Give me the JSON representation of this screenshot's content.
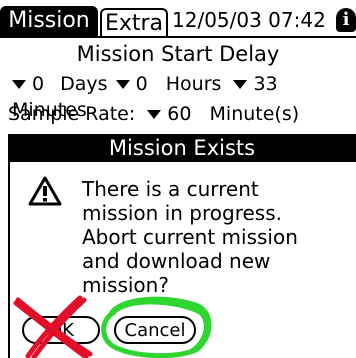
{
  "tabs": [
    {
      "label": "Mission"
    },
    {
      "label": "Extra"
    }
  ],
  "datetime": "12/05/03 07:42",
  "info_glyph": "i",
  "start_delay": {
    "heading": "Mission Start Delay",
    "days_value": "0",
    "days_label": "Days",
    "hours_value": "0",
    "hours_label": "Hours",
    "minutes_value": "33",
    "minutes_label": "Minutes"
  },
  "sample_rate": {
    "label": "Sample Rate:",
    "value": "60",
    "unit": "Minute(s)"
  },
  "dialog": {
    "title": "Mission Exists",
    "icon": "warning-icon",
    "message": "There is a current\nmission in progress.\nAbort current mission\nand download new\nmission?",
    "ok_label": "OK",
    "cancel_label": "Cancel"
  },
  "annotations": {
    "x_color": "#e0102a",
    "circle_color": "#2fd62f"
  }
}
